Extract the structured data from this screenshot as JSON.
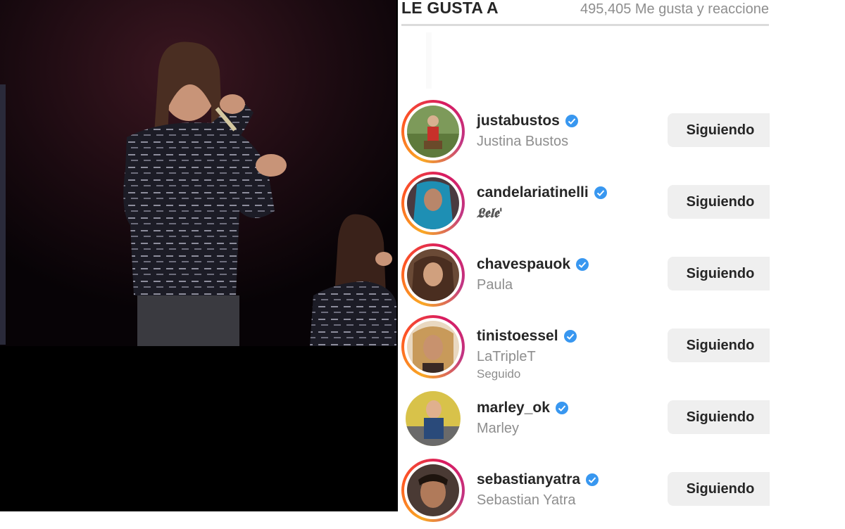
{
  "header": {
    "title": "LE GUSTA A",
    "likes_count": "495,405 Me gusta y reaccione"
  },
  "users": [
    {
      "username": "justabustos",
      "full_name": "Justina Bustos",
      "subtitle": "",
      "button_label": "Siguiendo",
      "avatar_color": "#6b8f4e"
    },
    {
      "username": "candelariatinelli",
      "full_name": "𝕷𝖊𝖑𝖊'",
      "subtitle": "",
      "button_label": "Siguiendo",
      "avatar_color": "#2aa6c8"
    },
    {
      "username": "chavespauok",
      "full_name": "Paula",
      "subtitle": "",
      "button_label": "Siguiendo",
      "avatar_color": "#8a5a3a"
    },
    {
      "username": "tinistoessel",
      "full_name": "LaTripleT",
      "subtitle": "Seguido",
      "button_label": "Siguiendo",
      "avatar_color": "#c89a5a"
    },
    {
      "username": "marley_ok",
      "full_name": "Marley",
      "subtitle": "",
      "button_label": "Siguiendo",
      "avatar_color": "#3f6ea8"
    },
    {
      "username": "sebastianyatra",
      "full_name": "Sebastian Yatra",
      "subtitle": "",
      "button_label": "Siguiendo",
      "avatar_color": "#6a4a3a"
    }
  ],
  "colors": {
    "verified": "#3897f0",
    "button_bg": "#efefef",
    "text_primary": "#262626",
    "text_secondary": "#8e8e8e"
  }
}
